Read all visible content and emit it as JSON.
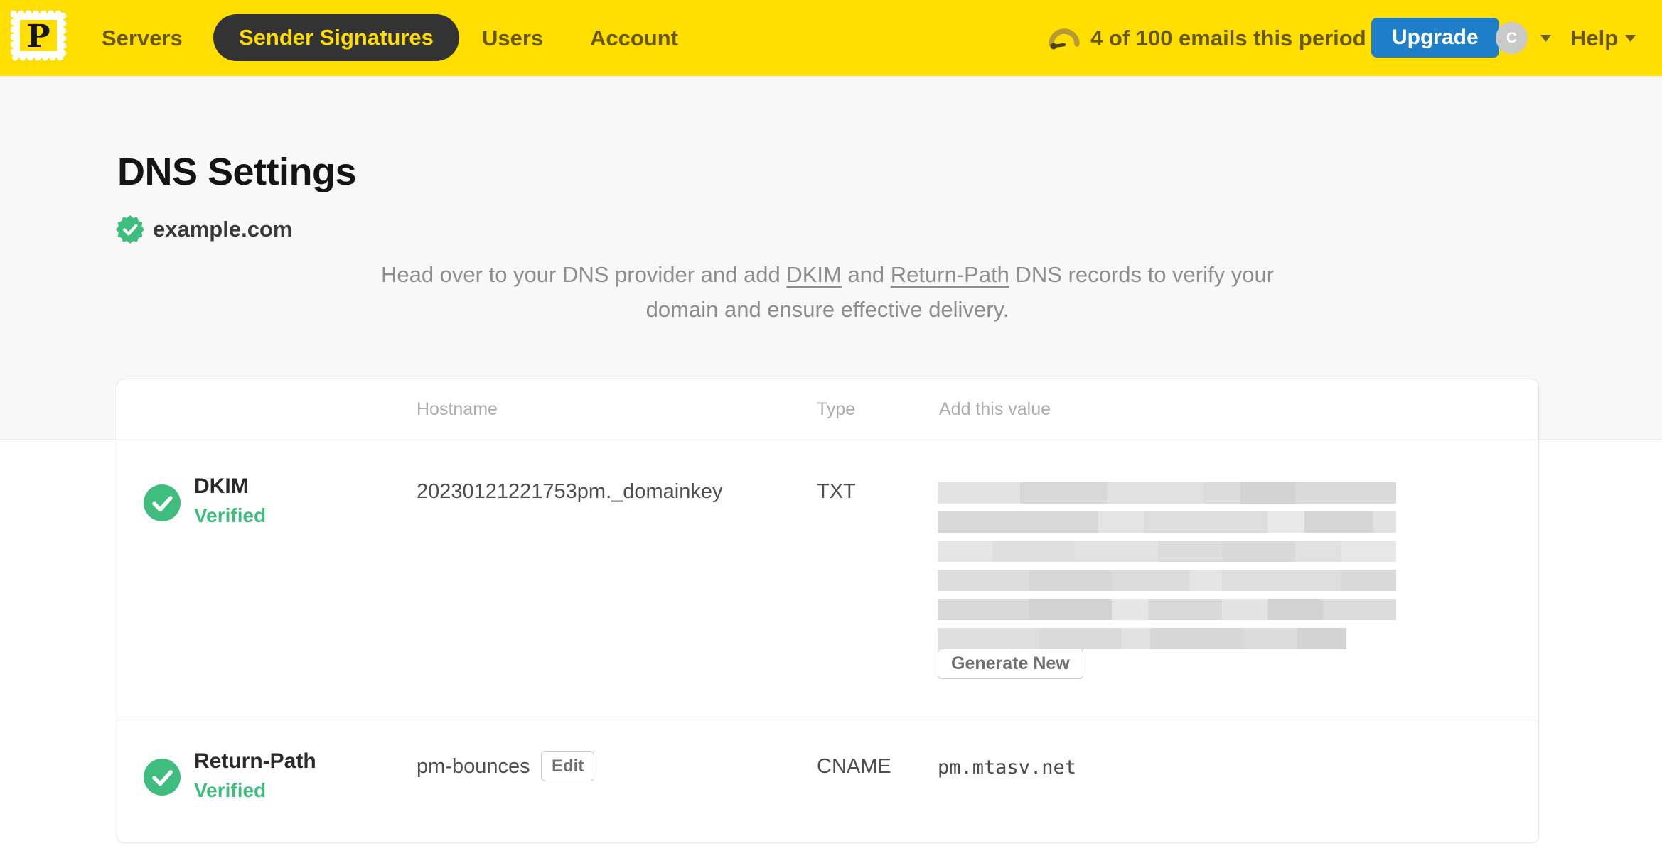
{
  "nav": {
    "logo_letter": "P",
    "items": [
      {
        "label": "Servers",
        "active": false
      },
      {
        "label": "Sender Signatures",
        "active": true
      },
      {
        "label": "Users",
        "active": false
      },
      {
        "label": "Account",
        "active": false
      }
    ],
    "usage_text": "4 of 100 emails this period",
    "upgrade_label": "Upgrade",
    "avatar_initial": "C",
    "help_label": "Help"
  },
  "page": {
    "title": "DNS Settings",
    "domain": "example.com",
    "domain_verified": true,
    "description": {
      "part1": "Head over to your DNS provider and add ",
      "dkim_link": "DKIM",
      "part2": " and ",
      "return_path_link": "Return-Path",
      "part3": " DNS records to verify your domain and ensure effective delivery."
    }
  },
  "table": {
    "headers": {
      "hostname": "Hostname",
      "type": "Type",
      "value": "Add this value"
    },
    "rows": [
      {
        "name": "DKIM",
        "status": "Verified",
        "hostname": "20230121221753pm._domainkey",
        "type": "TXT",
        "value_redacted": true,
        "redacted_lines": 6,
        "action_label": "Generate New"
      },
      {
        "name": "Return-Path",
        "status": "Verified",
        "hostname": "pm-bounces",
        "edit_label": "Edit",
        "type": "CNAME",
        "value": "pm.mtasv.net"
      }
    ]
  },
  "icons": {
    "logo": "postmark-stamp-logo",
    "usage": "gauge-icon",
    "domain_badge": "verified-seal-icon",
    "row_status": "check-circle-icon",
    "dropdowns": "caret-down-icon"
  },
  "colors": {
    "brand_yellow": "#FFDE00",
    "nav_active_bg": "#333333",
    "upgrade_blue": "#1E7EC8",
    "success_green": "#3EBD7E",
    "page_band": "#F8F8F8"
  }
}
